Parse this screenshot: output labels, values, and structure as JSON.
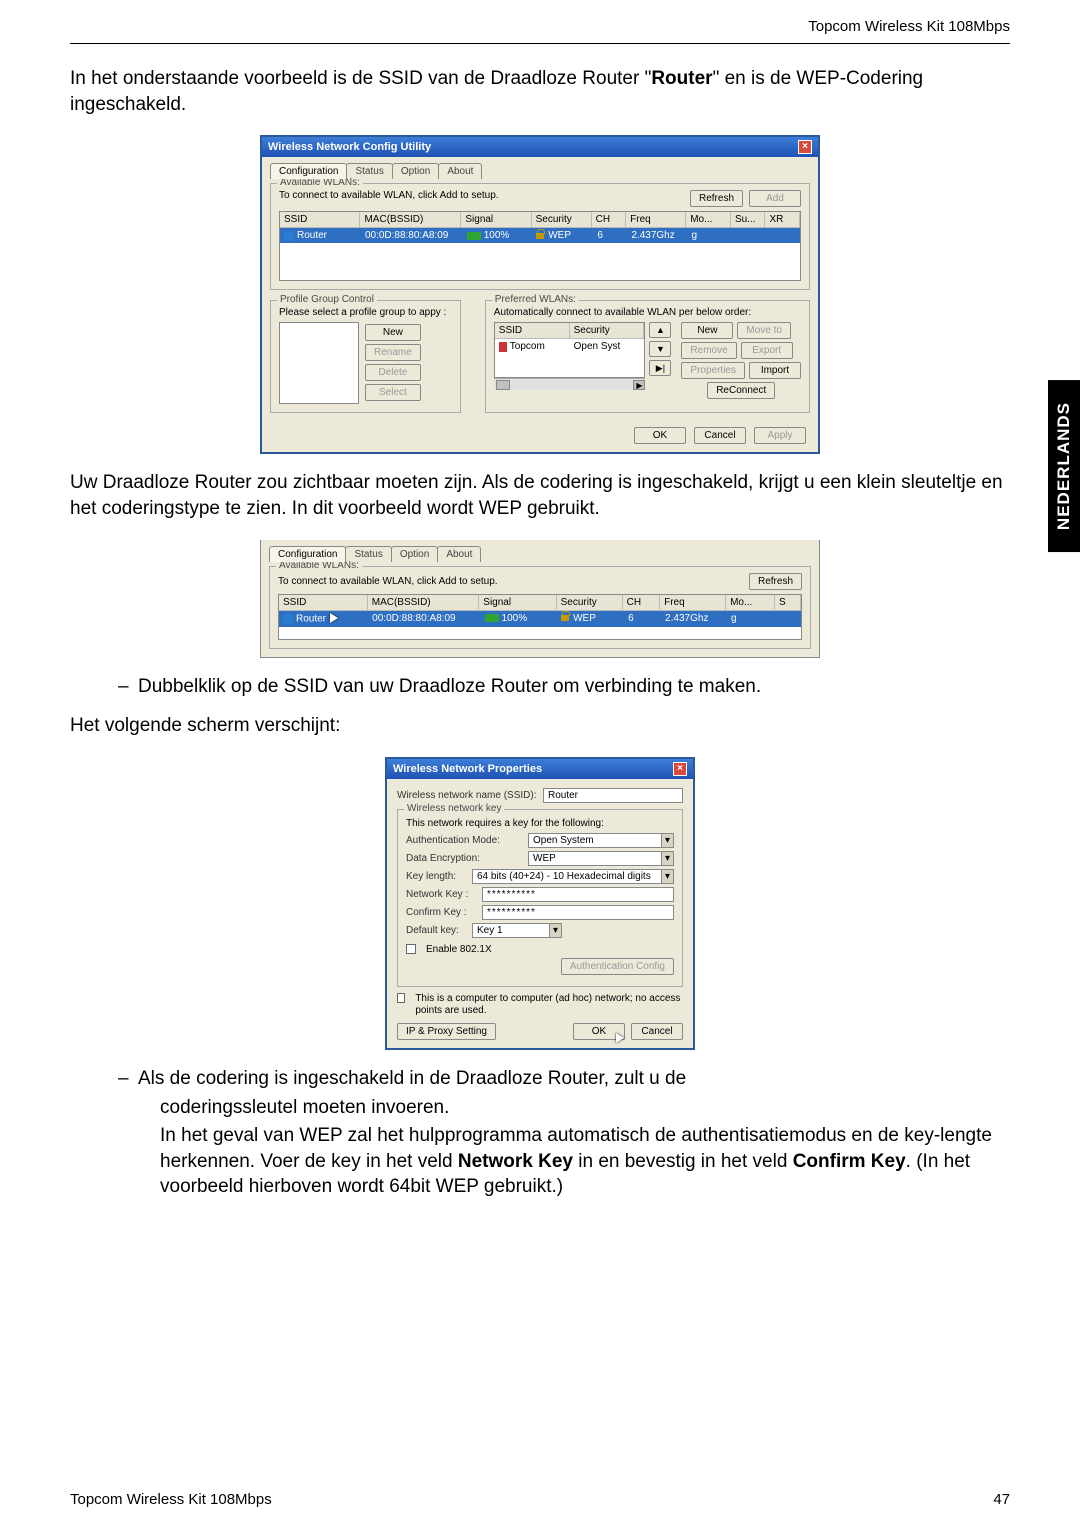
{
  "doc": {
    "header_product": "Topcom Wireless Kit 108Mbps",
    "side_tab": "NEDERLANDS",
    "footer_left": "Topcom Wireless Kit 108Mbps",
    "footer_page": "47",
    "p1_a": "In het onderstaande voorbeeld is de SSID van de Draadloze Router \"",
    "p1_bold": "Router",
    "p1_b": "\" en is de WEP-Codering ingeschakeld.",
    "p2": "Uw Draadloze Router zou zichtbaar moeten zijn. Als de codering is ingeschakeld, krijgt u een klein sleuteltje en het coderingstype te zien. In dit voorbeeld wordt WEP gebruikt.",
    "bullet1": "Dubbelklik op de SSID van uw Draadloze Router om verbinding te maken.",
    "p3": "Het volgende scherm verschijnt:",
    "bullet2_l1": "Als de codering is ingeschakeld in de Draadloze Router, zult u de",
    "bullet2_l2": "coderingssleutel moeten invoeren.",
    "bullet2_l3a": "In het geval van WEP zal het hulpprogramma automatisch de authentisatiemodus en de key-lengte herkennen. Voer de key in het veld ",
    "bullet2_l3b": "Network Key",
    "bullet2_l3c": " in en bevestig in het veld ",
    "bullet2_l3d": "Confirm Key",
    "bullet2_l3e": ". (In het voorbeeld hierboven wordt 64bit WEP gebruikt.)"
  },
  "dlg1": {
    "title": "Wireless Network Config Utility",
    "tabs": [
      "Configuration",
      "Status",
      "Option",
      "About"
    ],
    "group_available": "Available WLANs:",
    "available_note": "To connect to available WLAN, click Add to setup.",
    "refresh": "Refresh",
    "add": "Add",
    "cols": {
      "ssid": "SSID",
      "mac": "MAC(BSSID)",
      "signal": "Signal",
      "security": "Security",
      "ch": "CH",
      "freq": "Freq",
      "mo": "Mo...",
      "su": "Su...",
      "xr": "XR"
    },
    "row": {
      "ssid": "Router",
      "mac": "00:0D:88:80:A8:09",
      "signal": "100%",
      "security": "WEP",
      "ch": "6",
      "freq": "2.437Ghz",
      "mo": "g"
    },
    "group_profile": "Profile Group Control",
    "profile_note": "Please select a profile group to appy :",
    "profile_btns": {
      "new": "New",
      "rename": "Rename",
      "delete": "Delete",
      "select": "Select"
    },
    "group_preferred": "Preferred WLANs:",
    "preferred_note": "Automatically connect to available WLAN per below order:",
    "pref_cols": {
      "ssid": "SSID",
      "security": "Security"
    },
    "pref_row": {
      "ssid": "Topcom",
      "security": "Open Syst"
    },
    "pref_btns": {
      "new": "New",
      "moveto": "Move to",
      "remove": "Remove",
      "export": "Export",
      "properties": "Properties",
      "import": "Import",
      "reconnect": "ReConnect"
    },
    "ok": "OK",
    "cancel": "Cancel",
    "apply": "Apply"
  },
  "dlg2": {
    "tabs": [
      "Configuration",
      "Status",
      "Option",
      "About"
    ],
    "group_available": "Available WLANs:",
    "available_note": "To connect to available WLAN, click Add to setup.",
    "refresh": "Refresh",
    "cols": {
      "ssid": "SSID",
      "mac": "MAC(BSSID)",
      "signal": "Signal",
      "security": "Security",
      "ch": "CH",
      "freq": "Freq",
      "mo": "Mo...",
      "s": "S"
    },
    "row": {
      "ssid": "Router",
      "mac": "00:0D:88:80:A8:09",
      "signal": "100%",
      "security": "WEP",
      "ch": "6",
      "freq": "2.437Ghz",
      "mo": "g"
    }
  },
  "dlg3": {
    "title": "Wireless Network Properties",
    "ssid_label": "Wireless network name (SSID):",
    "ssid_value": "Router",
    "group_key": "Wireless network key",
    "key_note": "This network requires a key for the following:",
    "auth_mode_label": "Authentication Mode:",
    "auth_mode_value": "Open System",
    "data_enc_label": "Data Encryption:",
    "data_enc_value": "WEP",
    "key_len_label": "Key length:",
    "key_len_value": "64 bits (40+24) - 10 Hexadecimal digits",
    "net_key_label": "Network Key :",
    "net_key_value": "**********",
    "confirm_key_label": "Confirm Key :",
    "confirm_key_value": "**********",
    "default_key_label": "Default key:",
    "default_key_value": "Key 1",
    "enable_8021x": "Enable 802.1X",
    "auth_config": "Authentication Config",
    "adhoc_note": "This is a computer to computer (ad hoc) network; no access points are used.",
    "ip_proxy": "IP & Proxy Setting",
    "ok": "OK",
    "cancel": "Cancel"
  }
}
